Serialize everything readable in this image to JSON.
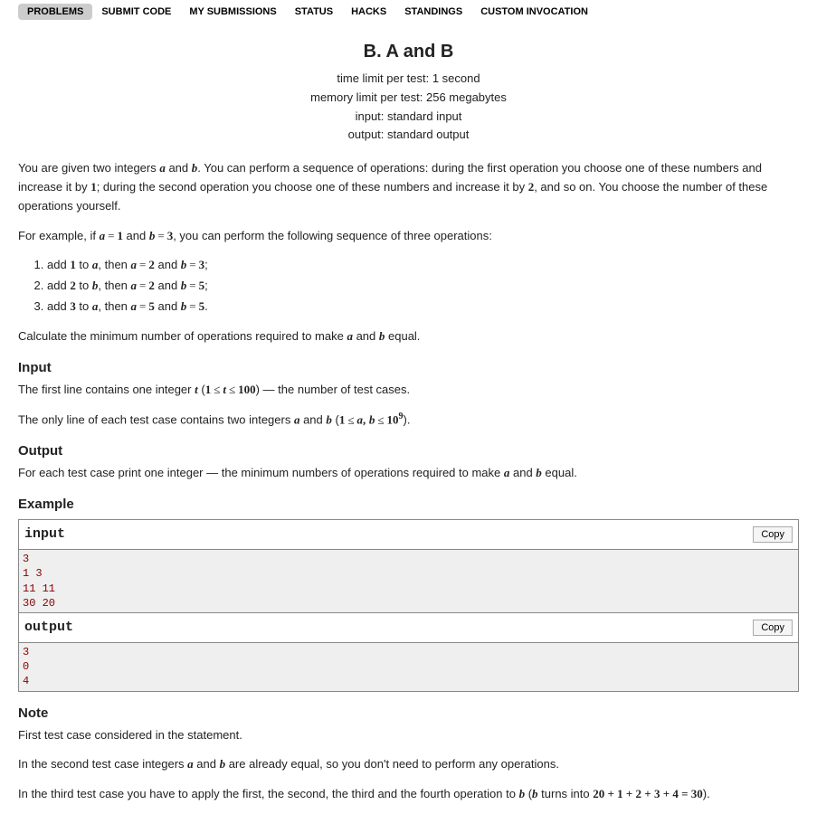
{
  "tabs": [
    {
      "label": "PROBLEMS",
      "active": true
    },
    {
      "label": "SUBMIT CODE",
      "active": false
    },
    {
      "label": "MY SUBMISSIONS",
      "active": false
    },
    {
      "label": "STATUS",
      "active": false
    },
    {
      "label": "HACKS",
      "active": false
    },
    {
      "label": "STANDINGS",
      "active": false
    },
    {
      "label": "CUSTOM INVOCATION",
      "active": false
    }
  ],
  "problem": {
    "title": "B. A and B",
    "time_limit": "time limit per test: 1 second",
    "memory_limit": "memory limit per test: 256 megabytes",
    "input_file": "input: standard input",
    "output_file": "output: standard output"
  },
  "sections": {
    "input_heading": "Input",
    "output_heading": "Output",
    "example_heading": "Example",
    "note_heading": "Note"
  },
  "sample": {
    "input_label": "input",
    "output_label": "output",
    "copy_label": "Copy",
    "input_data": "3\n1 3\n11 11\n30 20",
    "output_data": "3\n0\n4"
  },
  "text": {
    "p1_a": "You are given two integers ",
    "p1_b": " and ",
    "p1_c": ". You can perform a sequence of operations: during the first operation you choose one of these numbers and increase it by ",
    "p1_d": "; during the second operation you choose one of these numbers and increase it by ",
    "p1_e": ", and so on. You choose the number of these operations yourself.",
    "p2_a": "For example, if ",
    "p2_b": " and ",
    "p2_c": ", you can perform the following sequence of three operations:",
    "li1_a": "add ",
    "li1_b": " to ",
    "li1_c": ", then ",
    "li1_d": " and ",
    "li2_a": "add ",
    "li2_b": " to ",
    "li2_c": ", then ",
    "li2_d": " and ",
    "li3_a": "add ",
    "li3_b": " to ",
    "li3_c": ", then ",
    "li3_d": " and ",
    "p3_a": "Calculate the minimum number of operations required to make ",
    "p3_b": " and ",
    "p3_c": " equal.",
    "in1_a": "The first line contains one integer ",
    "in1_b": " — the number of test cases.",
    "in2_a": "The only line of each test case contains two integers ",
    "in2_b": " and ",
    "out1_a": "For each test case print one integer — the minimum numbers of operations required to make ",
    "out1_b": " and ",
    "out1_c": " equal.",
    "note1": "First test case considered in the statement.",
    "note2_a": "In the second test case integers ",
    "note2_b": " and ",
    "note2_c": " are already equal, so you don't need to perform any operations.",
    "note3_a": "In the third test case you have to apply the first, the second, the third and the fourth operation to ",
    "note3_b": " (",
    "note3_c": " turns into "
  },
  "math": {
    "a": "a",
    "b": "b",
    "t": "t",
    "n1": "1",
    "n2": "2",
    "n3": "3",
    "n5": "5",
    "n100": "100",
    "n10": "10",
    "n9": "9",
    "eq": "=",
    "le": "≤",
    "comma": ",",
    "thirty": "20 + 1 + 2 + 3 + 4 = 30",
    "rparen": ")."
  }
}
